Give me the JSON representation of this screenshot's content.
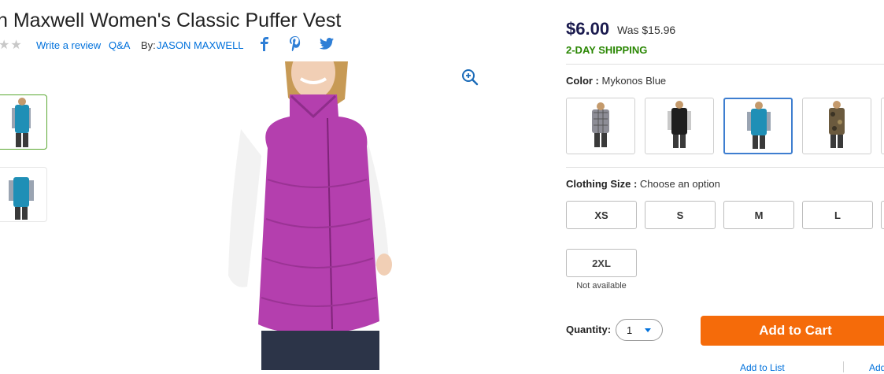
{
  "product": {
    "title": "n Maxwell Women's Classic Puffer Vest",
    "rating_stars": "★★",
    "write_review": "Write a review",
    "qa": "Q&A",
    "by_label": "By:",
    "brand": "JASON MAXWELL"
  },
  "pricing": {
    "price": "$6.00",
    "was": "Was $15.96",
    "shipping": "2-DAY SHIPPING"
  },
  "color": {
    "label": "Color :",
    "value": "Mykonos Blue",
    "swatches": [
      {
        "name": "plaid",
        "selected": false
      },
      {
        "name": "black",
        "selected": false
      },
      {
        "name": "mykonos-blue",
        "selected": true
      },
      {
        "name": "camo",
        "selected": false
      }
    ]
  },
  "size": {
    "label": "Clothing Size :",
    "value": "Choose an option",
    "options": [
      "XS",
      "S",
      "M",
      "L",
      "2XL"
    ],
    "unavailable_note": "Not available"
  },
  "quantity": {
    "label": "Quantity:",
    "value": "1"
  },
  "actions": {
    "add_to_cart": "Add to Cart",
    "add_to_list": "Add to List",
    "add_to_registry": "Add"
  },
  "colors": {
    "accent_blue": "#0071dc",
    "cart_orange": "#f56b0a",
    "shipping_green": "#2a8703",
    "vest_magenta": "#b43fae",
    "vest_teal": "#1f8fb6"
  },
  "icons": [
    "zoom-in-icon",
    "facebook-icon",
    "pinterest-icon",
    "twitter-icon"
  ]
}
